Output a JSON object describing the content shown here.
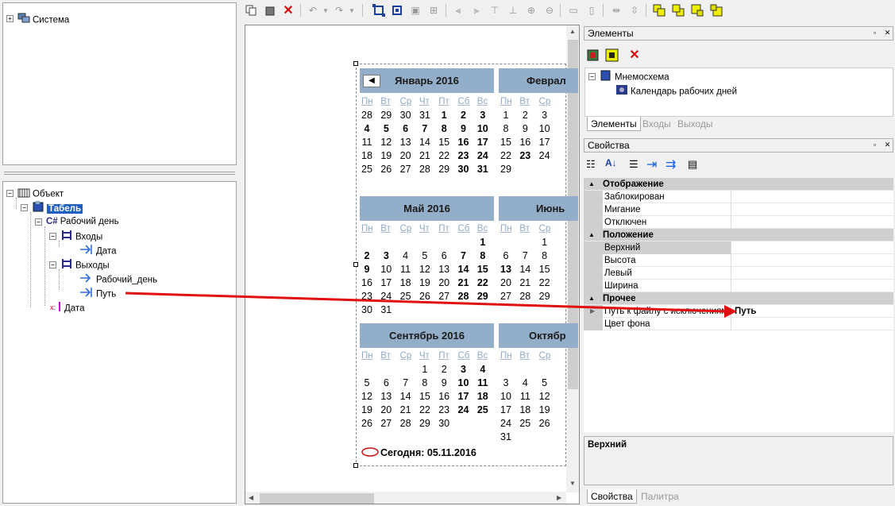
{
  "left_tree_top": {
    "item": "Система"
  },
  "left_tree_bottom": {
    "items": [
      {
        "label": "Объект"
      },
      {
        "label": "Табель"
      },
      {
        "label": "Рабочий день"
      },
      {
        "label": "Входы"
      },
      {
        "label": "Дата"
      },
      {
        "label": "Выходы"
      },
      {
        "label": "Рабочий_день"
      },
      {
        "label": "Путь"
      },
      {
        "label": "Дата"
      }
    ]
  },
  "calendar": {
    "prev_button": "◀",
    "dow": [
      "Пн",
      "Вт",
      "Ср",
      "Чт",
      "Пт",
      "Сб",
      "Вс"
    ],
    "today_label": "Сегодня: 05.11.2016",
    "months": [
      {
        "title": "Январь 2016"
      },
      {
        "title": "Феврал"
      },
      {
        "title": "Май 2016"
      },
      {
        "title": "Июнь"
      },
      {
        "title": "Сентябрь 2016"
      },
      {
        "title": "Октябр"
      }
    ]
  },
  "elements_panel": {
    "title": "Элементы",
    "tree_root": "Мнемосхема",
    "tree_child": "Календарь рабочих дней",
    "tabs": [
      "Элементы",
      "Входы",
      "Выходы"
    ]
  },
  "properties_panel": {
    "title": "Свойства",
    "categories": [
      {
        "name": "Отображение",
        "props": [
          "Заблокирован",
          "Мигание",
          "Отключен"
        ]
      },
      {
        "name": "Положение",
        "props": [
          "Верхний",
          "Высота",
          "Левый",
          "Ширина"
        ]
      },
      {
        "name": "Прочее",
        "props": [
          "Путь к файлу с исключениями",
          "Цвет фона"
        ]
      }
    ],
    "path_value": "Путь",
    "description": "Верхний",
    "tabs": [
      "Свойства",
      "Палитра"
    ]
  },
  "colors": {
    "month_header": "#93aec9",
    "arrow": "#e01010",
    "category": "#cfcfcf"
  }
}
